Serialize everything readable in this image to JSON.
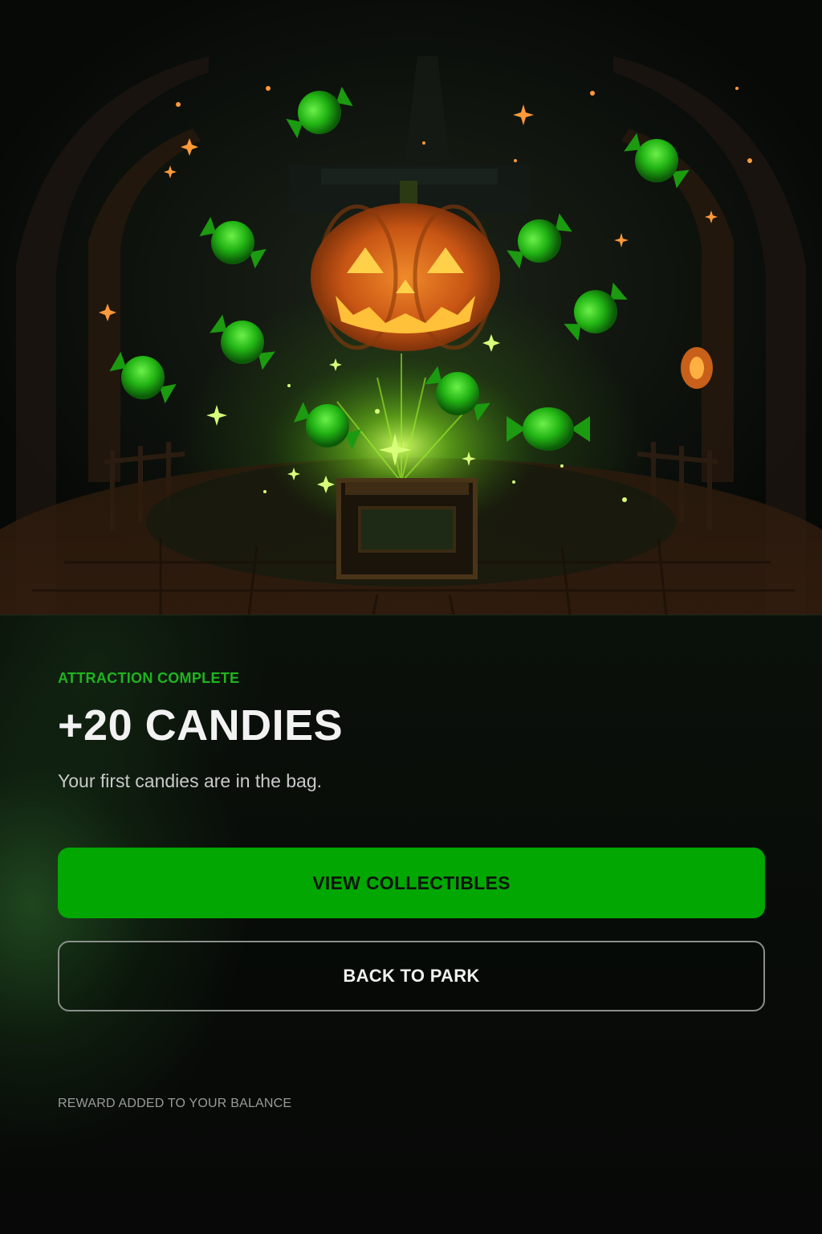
{
  "hero": {
    "scene_icon": "pumpkin-candy-chest-scene",
    "colors": {
      "candy": "#2fc41f",
      "pumpkin": "#e8731c",
      "glow": "#9ff02a"
    }
  },
  "status": {
    "eyebrow": "ATTRACTION COMPLETE",
    "reward_title": "+20 CANDIES",
    "message": "Your first candies are in the bag."
  },
  "actions": {
    "primary_label": "VIEW COLLECTIBLES",
    "secondary_label": "BACK TO PARK"
  },
  "footer": {
    "note": "REWARD ADDED TO YOUR BALANCE"
  },
  "theme": {
    "accent": "#02a702",
    "text": "#f2f2f2",
    "background": "#050605"
  }
}
